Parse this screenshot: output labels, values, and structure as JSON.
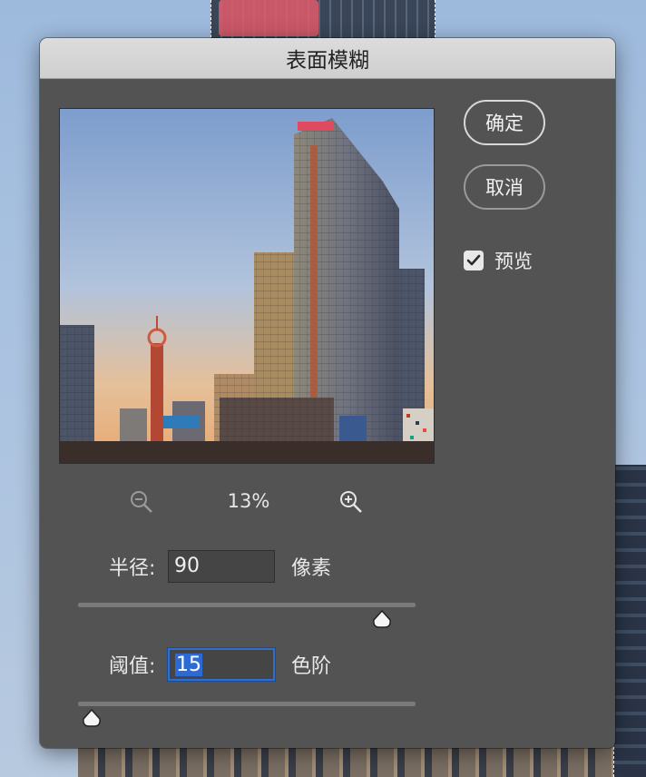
{
  "dialog": {
    "title": "表面模糊",
    "ok_label": "确定",
    "cancel_label": "取消",
    "preview_checkbox": {
      "label": "预览",
      "checked": true
    }
  },
  "zoom": {
    "value": "13%"
  },
  "radius": {
    "label": "半径:",
    "value": "90",
    "unit": "像素",
    "slider_fraction": 0.9
  },
  "threshold": {
    "label": "阈值:",
    "value": "15",
    "unit": "色阶",
    "slider_fraction": 0.04
  },
  "icons": [
    "zoom-out-icon",
    "zoom-in-icon",
    "checkmark-icon",
    "slider-thumb-icon"
  ],
  "colors": {
    "dialog_bg": "#535353",
    "titlebar_bg": "#d6d6d6",
    "focus_ring": "#2f6fd0",
    "selection": "#2c6bd6"
  }
}
